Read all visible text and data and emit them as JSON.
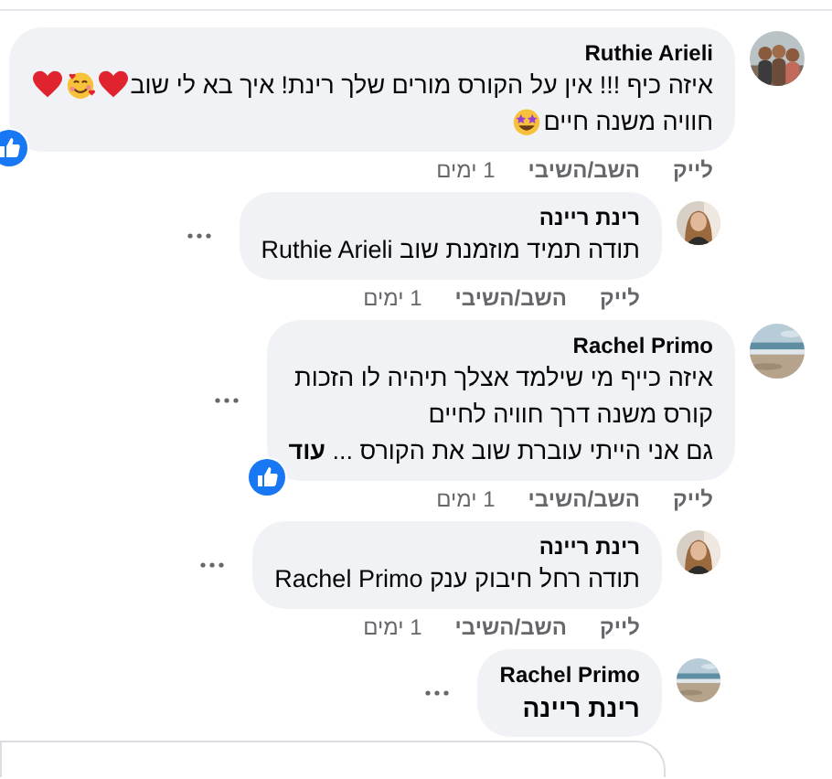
{
  "comments": [
    {
      "author": "Ruthie Arieli",
      "menu": false,
      "liked": true,
      "lines": [
        {
          "text": "איזה כיף !!! אין על הקורס מורים שלך רינת! איך בא לי שוב",
          "emojis": [
            {
              "kind": "heart"
            },
            {
              "kind": "smiling-hearts"
            },
            {
              "kind": "heart"
            }
          ]
        },
        {
          "text": "חוויה משנה חיים",
          "emojis": [
            {
              "kind": "star-eyes"
            }
          ]
        }
      ],
      "actions": {
        "like": "לייק",
        "reply": "השב/השיבי",
        "time": "1 ימים"
      },
      "replies": [
        {
          "author": "רינת ריינה",
          "menu": true,
          "liked": false,
          "lines": [
            {
              "text": "תודה תמיד מוזמנת שוב Ruthie Arieli"
            }
          ],
          "actions": {
            "like": "לייק",
            "reply": "השב/השיבי",
            "time": "1 ימים"
          }
        }
      ]
    },
    {
      "author": "Rachel Primo",
      "menu": true,
      "liked": true,
      "lines": [
        {
          "text": "איזה כייף מי שילמד אצלך תיהיה לו הזכות"
        },
        {
          "text": "קורס משנה דרך חוויה לחיים"
        },
        {
          "text": "גם אני הייתי עוברת שוב את הקורס ... **עוד**"
        }
      ],
      "actions": {
        "like": "לייק",
        "reply": "השב/השיבי",
        "time": "1 ימים"
      },
      "replies": [
        {
          "author": "רינת ריינה",
          "menu": true,
          "liked": false,
          "lines": [
            {
              "text": "תודה רחל חיבוק ענק Rachel Primo"
            }
          ],
          "actions": {
            "like": "לייק",
            "reply": "השב/השיבי",
            "time": "1 ימים"
          }
        },
        {
          "author": "Rachel Primo",
          "menu": true,
          "liked": false,
          "mention": "רינת ריינה"
        }
      ]
    }
  ]
}
